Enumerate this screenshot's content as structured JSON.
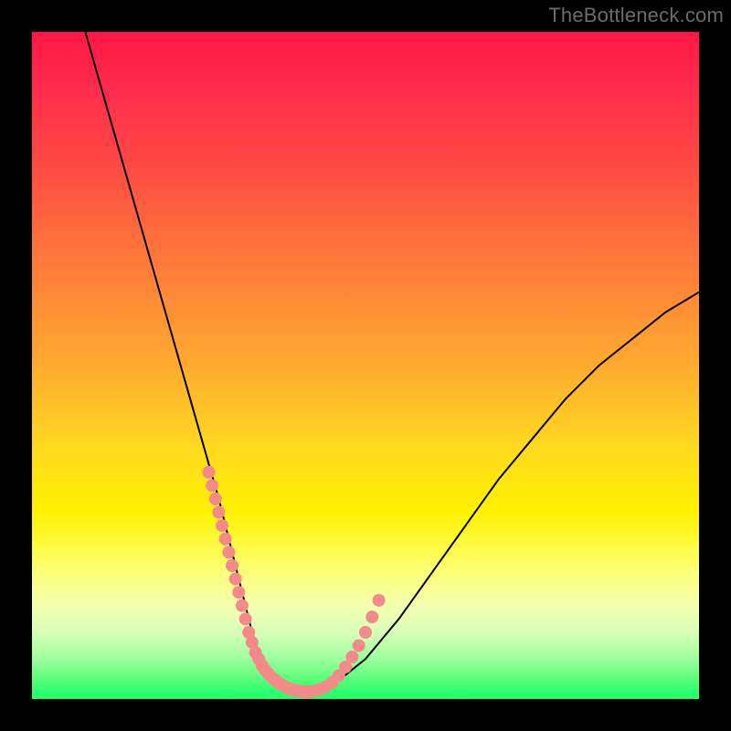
{
  "watermark": "TheBottleneck.com",
  "chart_data": {
    "type": "line",
    "title": "",
    "xlabel": "",
    "ylabel": "",
    "xlim": [
      0,
      100
    ],
    "ylim": [
      0,
      100
    ],
    "series": [
      {
        "name": "bottleneck-curve",
        "x": [
          8,
          10,
          12,
          14,
          16,
          18,
          20,
          22,
          24,
          26,
          28,
          30,
          31,
          32,
          33,
          34,
          35,
          36,
          37,
          38,
          39,
          40,
          42,
          45,
          50,
          55,
          60,
          65,
          70,
          75,
          80,
          85,
          90,
          95,
          100
        ],
        "values": [
          100,
          93,
          86,
          79,
          72,
          65,
          58,
          51,
          44,
          37,
          30,
          22,
          18,
          14,
          10,
          7,
          5,
          3,
          2,
          1.5,
          1.2,
          1,
          1.1,
          2,
          6,
          12,
          19,
          26,
          33,
          39,
          45,
          50,
          54,
          58,
          61
        ]
      }
    ],
    "highlight_points": {
      "name": "data-markers",
      "x": [
        26.5,
        27,
        27.5,
        28,
        28.5,
        29,
        29.5,
        30,
        30.5,
        31,
        31.5,
        32,
        32.5,
        33,
        33.5,
        34,
        34.5,
        35,
        35.5,
        36,
        36.5,
        37,
        37.5,
        38,
        38.5,
        39,
        39.5,
        40,
        40.5,
        41,
        41.5,
        42,
        43,
        44,
        45,
        46,
        47,
        48,
        49,
        50,
        51,
        52
      ],
      "values": [
        34,
        32,
        30,
        28,
        26,
        24,
        22,
        20,
        18,
        16,
        14,
        12,
        10,
        8.5,
        7,
        6,
        5,
        4.3,
        3.7,
        3.2,
        2.8,
        2.4,
        2.1,
        1.8,
        1.6,
        1.4,
        1.3,
        1.2,
        1.15,
        1.1,
        1.1,
        1.15,
        1.4,
        1.8,
        2.5,
        3.5,
        4.8,
        6.3,
        8,
        10,
        12.3,
        14.8
      ]
    },
    "colors": {
      "curve": "#000000",
      "markers": "#f48a8a",
      "gradient_top": "#ff1744",
      "gradient_mid": "#fff200",
      "gradient_bottom": "#1fff68"
    }
  }
}
